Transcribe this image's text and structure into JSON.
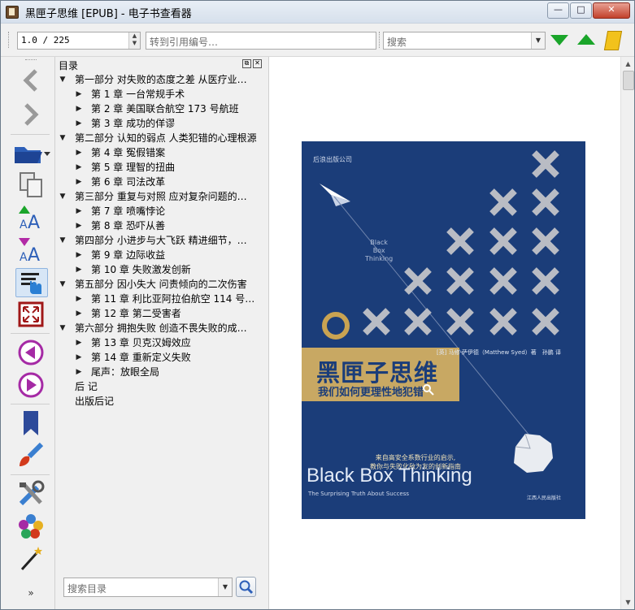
{
  "window": {
    "title": "黑匣子思维 [EPUB] - 电子书查看器",
    "minimize_glyph": "—",
    "maximize_glyph": "□",
    "close_glyph": "✕"
  },
  "toolbar": {
    "position_value": "1.0 / 225",
    "goto_ref_placeholder": "转到引用编号…",
    "search_placeholder": "搜索",
    "icons": [
      "next-match-icon",
      "previous-match-icon",
      "book-icon"
    ],
    "accent_green": "#1aa52a"
  },
  "sidebar": {
    "buttons": [
      "back",
      "forward",
      "open-book",
      "copy",
      "font-larger",
      "font-smaller",
      "table-of-contents",
      "fullscreen",
      "previous-page",
      "next-page",
      "bookmarks",
      "theme",
      "preferences",
      "metadata",
      "magic",
      "more"
    ]
  },
  "toc": {
    "title": "目录",
    "search_placeholder": "搜索目录",
    "items": [
      {
        "level": 0,
        "expanded": true,
        "label": "第一部分 对失败的态度之差 从医疗业…"
      },
      {
        "level": 1,
        "expanded": false,
        "label": "第 1 章 一台常规手术"
      },
      {
        "level": 1,
        "expanded": false,
        "label": "第 2 章 美国联合航空 173 号航班"
      },
      {
        "level": 1,
        "expanded": false,
        "label": "第 3 章 成功的佯谬"
      },
      {
        "level": 0,
        "expanded": true,
        "label": "第二部分 认知的弱点 人类犯错的心理根源"
      },
      {
        "level": 1,
        "expanded": false,
        "label": "第 4 章 冤假错案"
      },
      {
        "level": 1,
        "expanded": false,
        "label": "第 5 章 理智的扭曲"
      },
      {
        "level": 1,
        "expanded": false,
        "label": "第 6 章 司法改革"
      },
      {
        "level": 0,
        "expanded": true,
        "label": "第三部分 重复与对照 应对复杂问题的…"
      },
      {
        "level": 1,
        "expanded": false,
        "label": "第 7 章 喷嘴悖论"
      },
      {
        "level": 1,
        "expanded": false,
        "label": "第 8 章 恐吓从善"
      },
      {
        "level": 0,
        "expanded": true,
        "label": "第四部分 小进步与大飞跃 精进细节，…"
      },
      {
        "level": 1,
        "expanded": false,
        "label": "第 9 章 边际收益"
      },
      {
        "level": 1,
        "expanded": false,
        "label": "第 10 章 失败激发创新"
      },
      {
        "level": 0,
        "expanded": true,
        "label": "第五部分 因小失大 问责倾向的二次伤害"
      },
      {
        "level": 1,
        "expanded": false,
        "label": "第 11 章 利比亚阿拉伯航空 114 号…"
      },
      {
        "level": 1,
        "expanded": false,
        "label": "第 12 章 第二受害者"
      },
      {
        "level": 0,
        "expanded": true,
        "label": "第六部分 拥抱失败 创造不畏失败的成…"
      },
      {
        "level": 1,
        "expanded": false,
        "label": "第 13 章 贝克汉姆效应"
      },
      {
        "level": 1,
        "expanded": false,
        "label": "第 14 章 重新定义失败"
      },
      {
        "level": 1,
        "expanded": false,
        "label": "尾声：放眼全局"
      },
      {
        "level": 0,
        "leaf": true,
        "label": "后 记"
      },
      {
        "level": 0,
        "leaf": true,
        "label": "出版后记"
      }
    ]
  },
  "cover": {
    "publisher_mark": "后浪出版公司",
    "bbt_small": [
      "Black",
      "Box",
      "Thinking"
    ],
    "cn_title": "黑匣子思维",
    "cn_subtitle": "我们如何更理性地犯错",
    "author": "[英] 马修·萨伊德（Matthew Syed）著　孙鹏 译",
    "tag_line1": "来自高安全系数行业的启示,",
    "tag_line2": "教你与失败化敌为友的创新指南",
    "en_title": "Black Box Thinking",
    "en_tagline": "The Surprising Truth About Success",
    "publisher_logo": "江西人民出版社",
    "bg_color": "#1b3d79",
    "gold_color": "#c8a863"
  }
}
